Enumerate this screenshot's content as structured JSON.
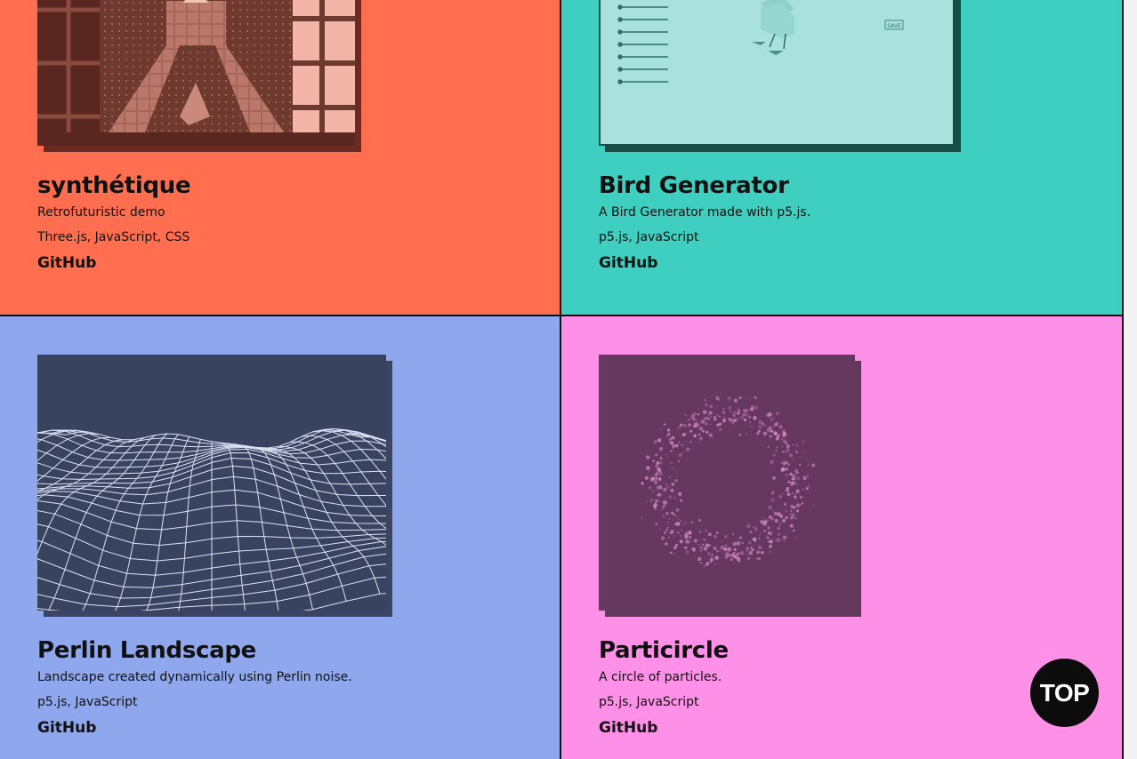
{
  "projects": [
    {
      "title": "synthétique",
      "description": "Retrofuturistic demo",
      "tech": "Three.js, JavaScript, CSS",
      "link_label": "GitHub",
      "bg": "#ff6f4f"
    },
    {
      "title": "Bird Generator",
      "description": "A Bird Generator made with p5.js.",
      "tech": "p5.js, JavaScript",
      "link_label": "GitHub",
      "bg": "#3ecfc1",
      "thumb_button": "SAVE"
    },
    {
      "title": "Perlin Landscape",
      "description": "Landscape created dynamically using Perlin noise.",
      "tech": "p5.js, JavaScript",
      "link_label": "GitHub",
      "bg": "#8fa8ed"
    },
    {
      "title": "Particircle",
      "description": "A circle of particles.",
      "tech": "p5.js, JavaScript",
      "link_label": "GitHub",
      "bg": "#ff90e8"
    }
  ],
  "top_button": {
    "label": "TOP"
  }
}
